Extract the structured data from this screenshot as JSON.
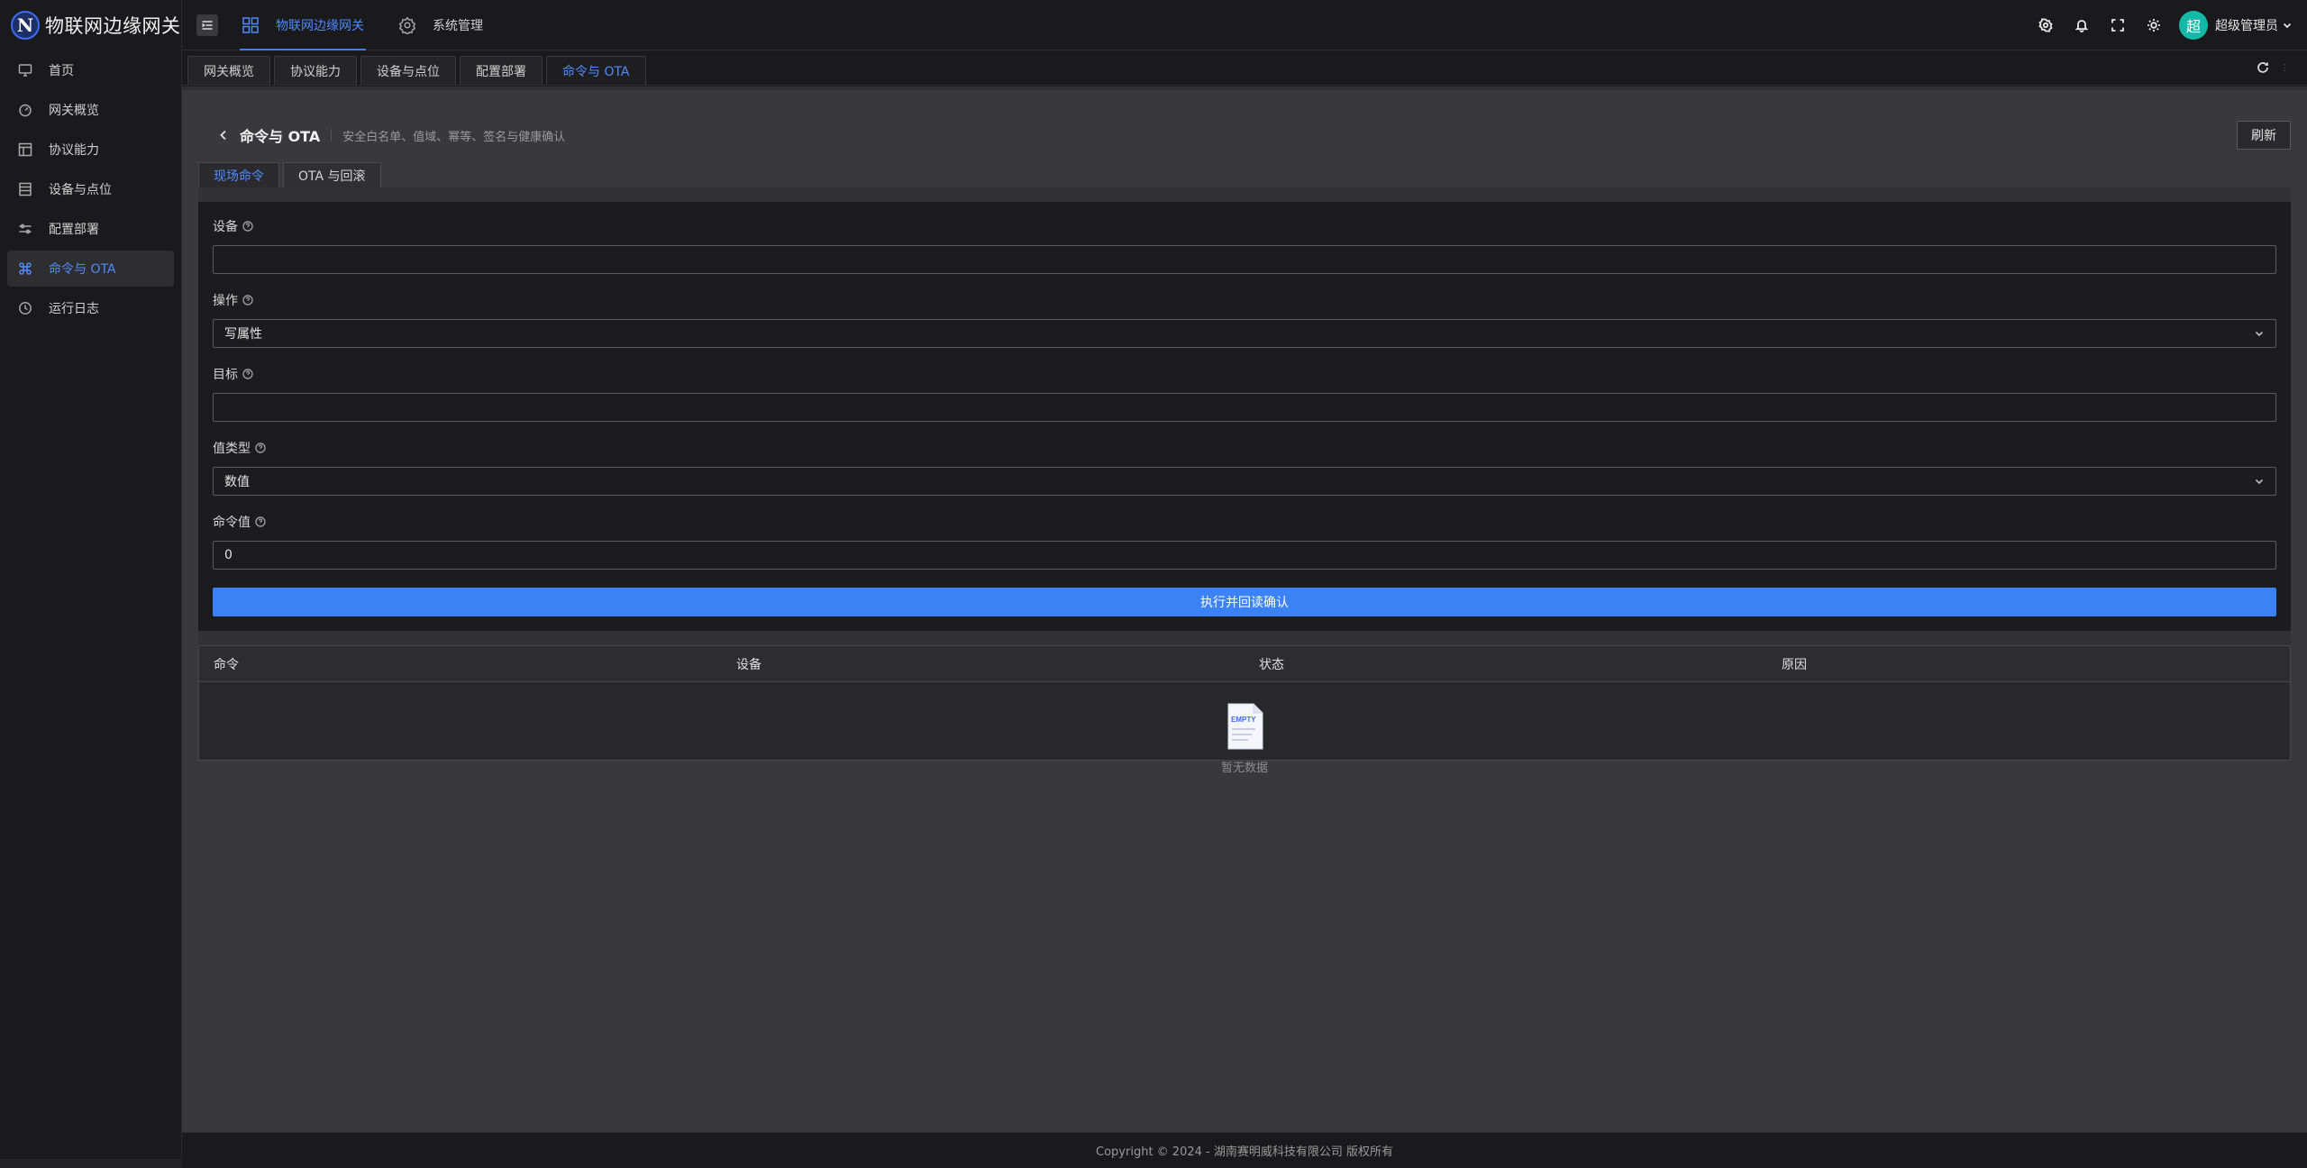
{
  "brand": {
    "logo_letter": "N",
    "title": "物联网边缘网关"
  },
  "sidebar": {
    "items": [
      {
        "label": "首页",
        "icon": "monitor-icon"
      },
      {
        "label": "网关概览",
        "icon": "dashboard-icon"
      },
      {
        "label": "协议能力",
        "icon": "layout-icon"
      },
      {
        "label": "设备与点位",
        "icon": "list-icon"
      },
      {
        "label": "配置部署",
        "icon": "sliders-icon"
      },
      {
        "label": "命令与 OTA",
        "icon": "command-icon",
        "active": true
      },
      {
        "label": "运行日志",
        "icon": "history-icon"
      }
    ]
  },
  "header": {
    "nav": [
      {
        "label": "物联网边缘网关",
        "icon": "grid-icon",
        "active": true
      },
      {
        "label": "系统管理",
        "icon": "gear-icon"
      }
    ],
    "avatar_text": "超",
    "user_name": "超级管理员"
  },
  "tabs": [
    "网关概览",
    "协议能力",
    "设备与点位",
    "配置部署",
    "命令与 OTA"
  ],
  "page": {
    "title": "命令与 OTA",
    "subtitle": "安全白名单、值域、幂等、签名与健康确认",
    "refresh_label": "刷新",
    "inner_tabs": [
      "现场命令",
      "OTA 与回滚"
    ]
  },
  "form": {
    "device": {
      "label": "设备",
      "value": ""
    },
    "operation": {
      "label": "操作",
      "value": "写属性"
    },
    "target": {
      "label": "目标",
      "value": ""
    },
    "value_type": {
      "label": "值类型",
      "value": "数值"
    },
    "command_value": {
      "label": "命令值",
      "value": "0"
    },
    "submit_label": "执行并回读确认"
  },
  "table": {
    "columns": [
      "命令",
      "设备",
      "状态",
      "原因"
    ],
    "rows": [],
    "empty_badge": "EMPTY",
    "empty_text": "暂无数据"
  },
  "footer": {
    "copyright": "Copyright © 2024 - 湖南赛明威科技有限公司 版权所有"
  },
  "colors": {
    "accent": "#3b82f6",
    "active_text": "#4f8bff",
    "avatar_bg": "#14b8a6"
  }
}
